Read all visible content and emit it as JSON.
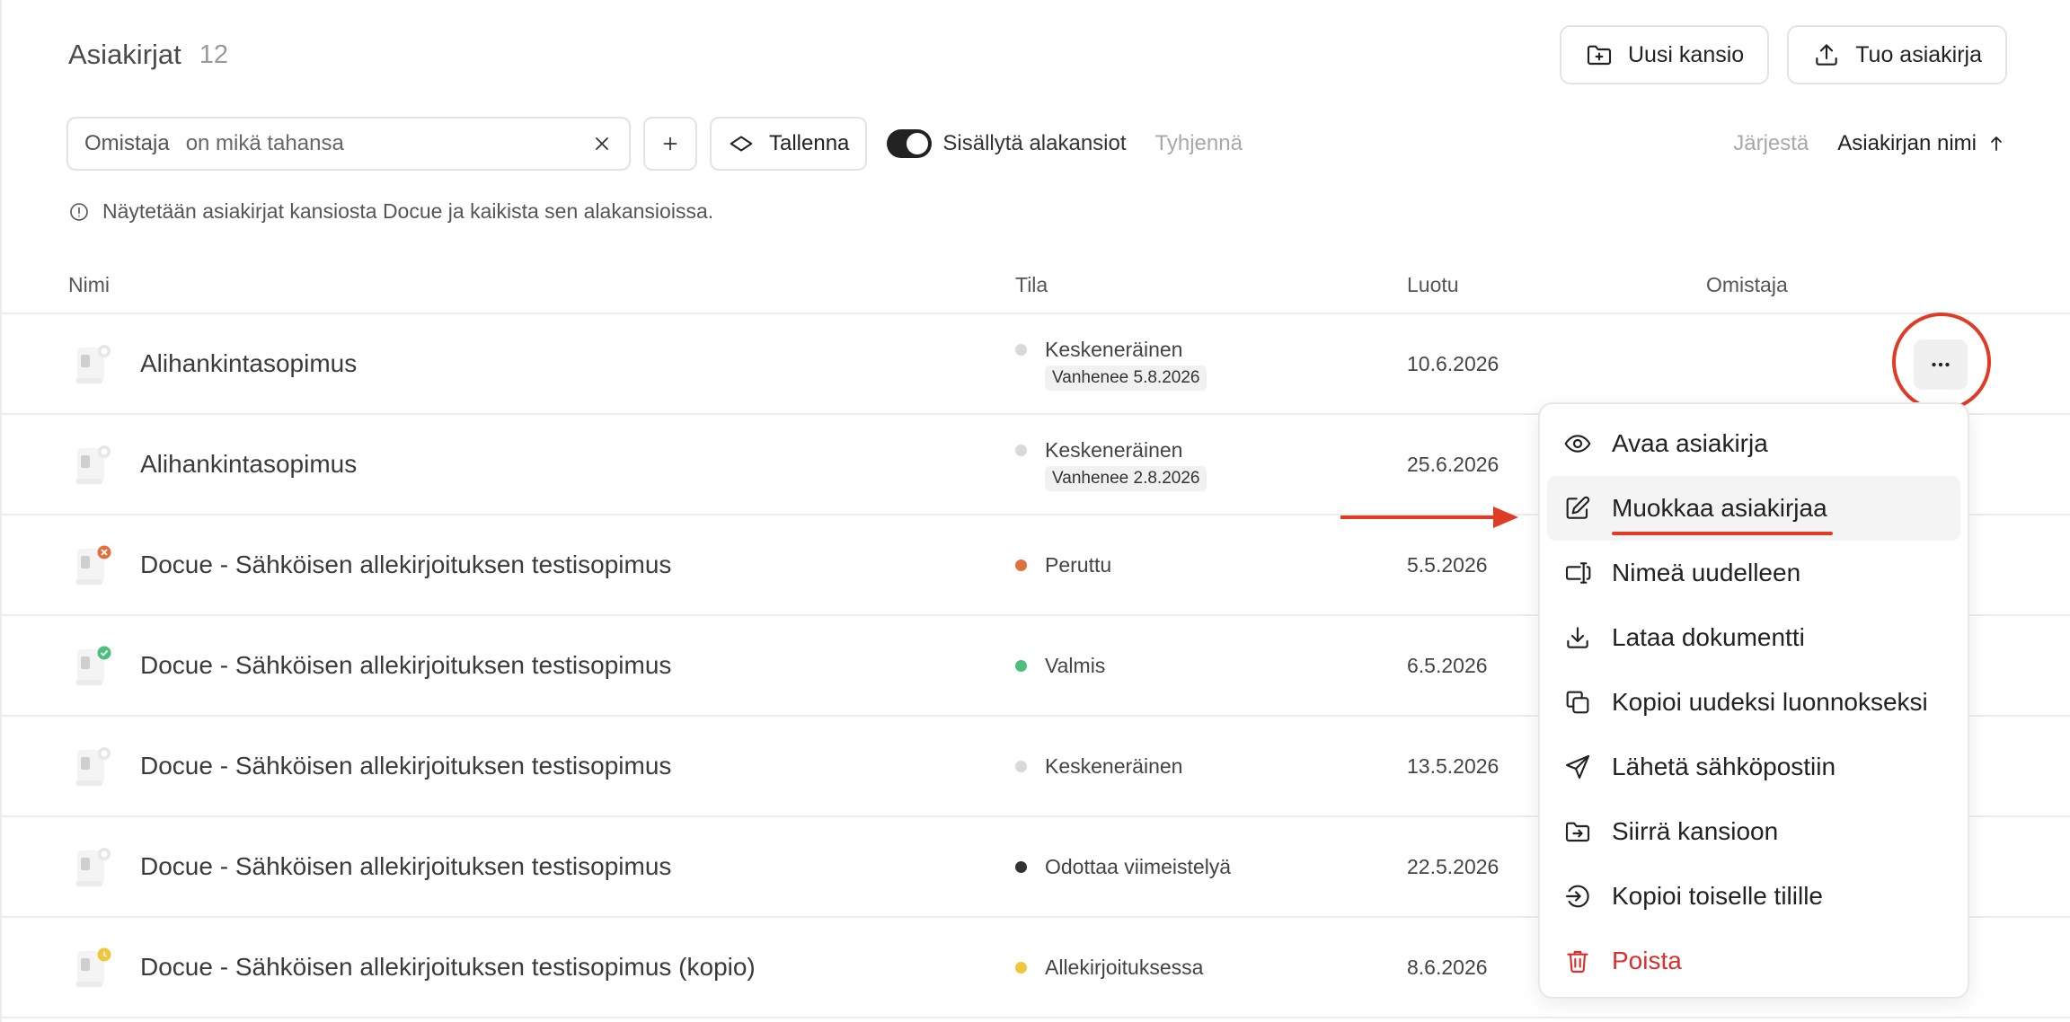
{
  "header": {
    "title": "Asiakirjat",
    "count": "12",
    "new_folder_label": "Uusi kansio",
    "import_label": "Tuo asiakirja"
  },
  "filters": {
    "owner_key": "Omistaja",
    "owner_value": "on mikä tahansa",
    "save_label": "Tallenna",
    "include_subfolders_label": "Sisällytä alakansiot",
    "include_subfolders_on": true,
    "clear_label": "Tyhjennä",
    "sort_label": "Järjestä",
    "sort_field": "Asiakirjan nimi"
  },
  "info_text": "Näytetään asiakirjat kansiosta Docue ja kaikista sen alakansioissa.",
  "table": {
    "columns": [
      "Nimi",
      "Tila",
      "Luotu",
      "Omistaja"
    ],
    "rows": [
      {
        "name": "Alihankintasopimus",
        "status": "Keskeneräinen",
        "expiry": "Vanhenee 5.8.2026",
        "created": "10.6.2026",
        "status_color": "#d9d9d9",
        "badge": "pending"
      },
      {
        "name": "Alihankintasopimus",
        "status": "Keskeneräinen",
        "expiry": "Vanhenee 2.8.2026",
        "created": "25.6.2026",
        "status_color": "#d9d9d9",
        "badge": "pending"
      },
      {
        "name": "Docue - Sähköisen allekirjoituksen testisopimus",
        "status": "Peruttu",
        "expiry": "",
        "created": "5.5.2026",
        "status_color": "#e0713f",
        "badge": "cancelled"
      },
      {
        "name": "Docue - Sähköisen allekirjoituksen testisopimus",
        "status": "Valmis",
        "expiry": "",
        "created": "6.5.2026",
        "status_color": "#4bbf7e",
        "badge": "done"
      },
      {
        "name": "Docue - Sähköisen allekirjoituksen testisopimus",
        "status": "Keskeneräinen",
        "expiry": "",
        "created": "13.5.2026",
        "status_color": "#d9d9d9",
        "badge": "pending"
      },
      {
        "name": "Docue - Sähköisen allekirjoituksen testisopimus",
        "status": "Odottaa viimeistelyä",
        "expiry": "",
        "created": "22.5.2026",
        "status_color": "#333333",
        "badge": "pending"
      },
      {
        "name": "Docue - Sähköisen allekirjoituksen testisopimus (kopio)",
        "status": "Allekirjoituksessa",
        "expiry": "",
        "created": "8.6.2026",
        "status_color": "#f0c63b",
        "badge": "signing"
      }
    ]
  },
  "menu": {
    "items": [
      {
        "label": "Avaa asiakirja",
        "icon": "eye-icon"
      },
      {
        "label": "Muokkaa asiakirjaa",
        "icon": "edit-icon"
      },
      {
        "label": "Nimeä uudelleen",
        "icon": "rename-icon"
      },
      {
        "label": "Lataa dokumentti",
        "icon": "download-icon"
      },
      {
        "label": "Kopioi uudeksi luonnokseksi",
        "icon": "copy-icon"
      },
      {
        "label": "Lähetä sähköpostiin",
        "icon": "send-icon"
      },
      {
        "label": "Siirrä kansioon",
        "icon": "move-folder-icon"
      },
      {
        "label": "Kopioi toiselle tilille",
        "icon": "login-icon"
      },
      {
        "label": "Poista",
        "icon": "trash-icon"
      }
    ]
  },
  "colors": {
    "accent_red": "#e03b24",
    "danger": "#d8302f"
  }
}
